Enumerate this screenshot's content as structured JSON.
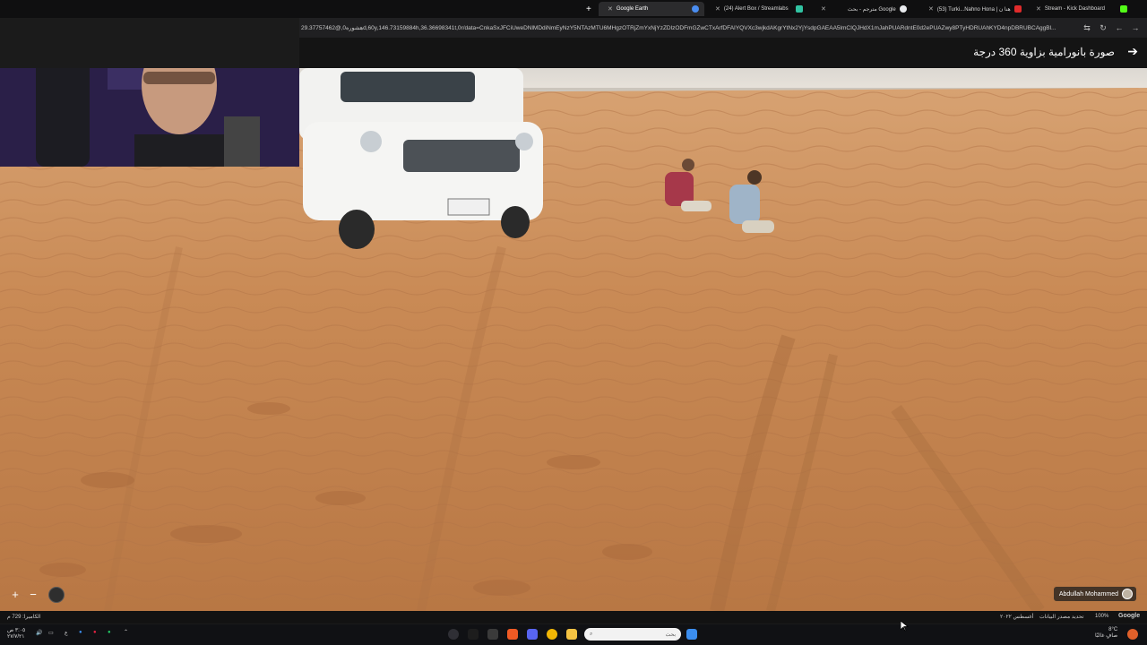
{
  "browser": {
    "tabs": [
      {
        "label": "Google Earth",
        "active": true,
        "color": "#4a8df0"
      },
      {
        "label": "(24) Alert Box / Streamlabs",
        "active": false,
        "color": "#31c3a2"
      },
      {
        "label": "مترجم - بحث Google",
        "active": false,
        "color": "#e8eaed"
      },
      {
        "label": "(53) Turki...Nahno Hona | هنا ن",
        "active": false,
        "color": "#e02b2b"
      },
      {
        "label": "Stream - Kick Dashboard",
        "active": false,
        "color": "#53fc18"
      }
    ],
    "new_tab_label": "+",
    "url": "29.37757462@,هشوره0d,60y,146.73159884h,36.36698341t,0r/data=CnkaSxJFCiUweDNlMDdiNmEyNzY5NTAzMTU6MHgzOTRjZmYxNjYzZDlzODFmGZwCTxArfDFAIYQVXc3wjkdAKgrYtNx2YjYsdpGAEAA5lmCIQJHdX1mJahPUARdntE0d2ePUAZwy8PTyHDRUAhKYD4npDBRUBCAggBl..."
  },
  "streetview": {
    "title": "صورة بانورامية بزاوية 360 درجة",
    "back_icon": "arrow-right-icon",
    "author": "Abdullah Mohammed",
    "zoom_in": "+",
    "zoom_out": "−"
  },
  "status": {
    "left": "الكاميرا: 729 م",
    "right_date": "أغسطس ٢٠٢٢",
    "right_update": "تحديد مصدر البيانات",
    "right_label": "تحديد",
    "zoom": "100%",
    "brand": "Google"
  },
  "taskbar": {
    "search_text": "بحث",
    "time": "٣:٠٥ ص",
    "date": "٢٧/٧/٢١",
    "lang": "ع",
    "weather_temp": "8°C",
    "weather_desc": "صافٍ غالبًا"
  },
  "colors": {
    "sand": "#c98a55",
    "sky": "#e8e4de",
    "chrome_bg": "#0f0f10",
    "accent": "#4a8df0"
  }
}
